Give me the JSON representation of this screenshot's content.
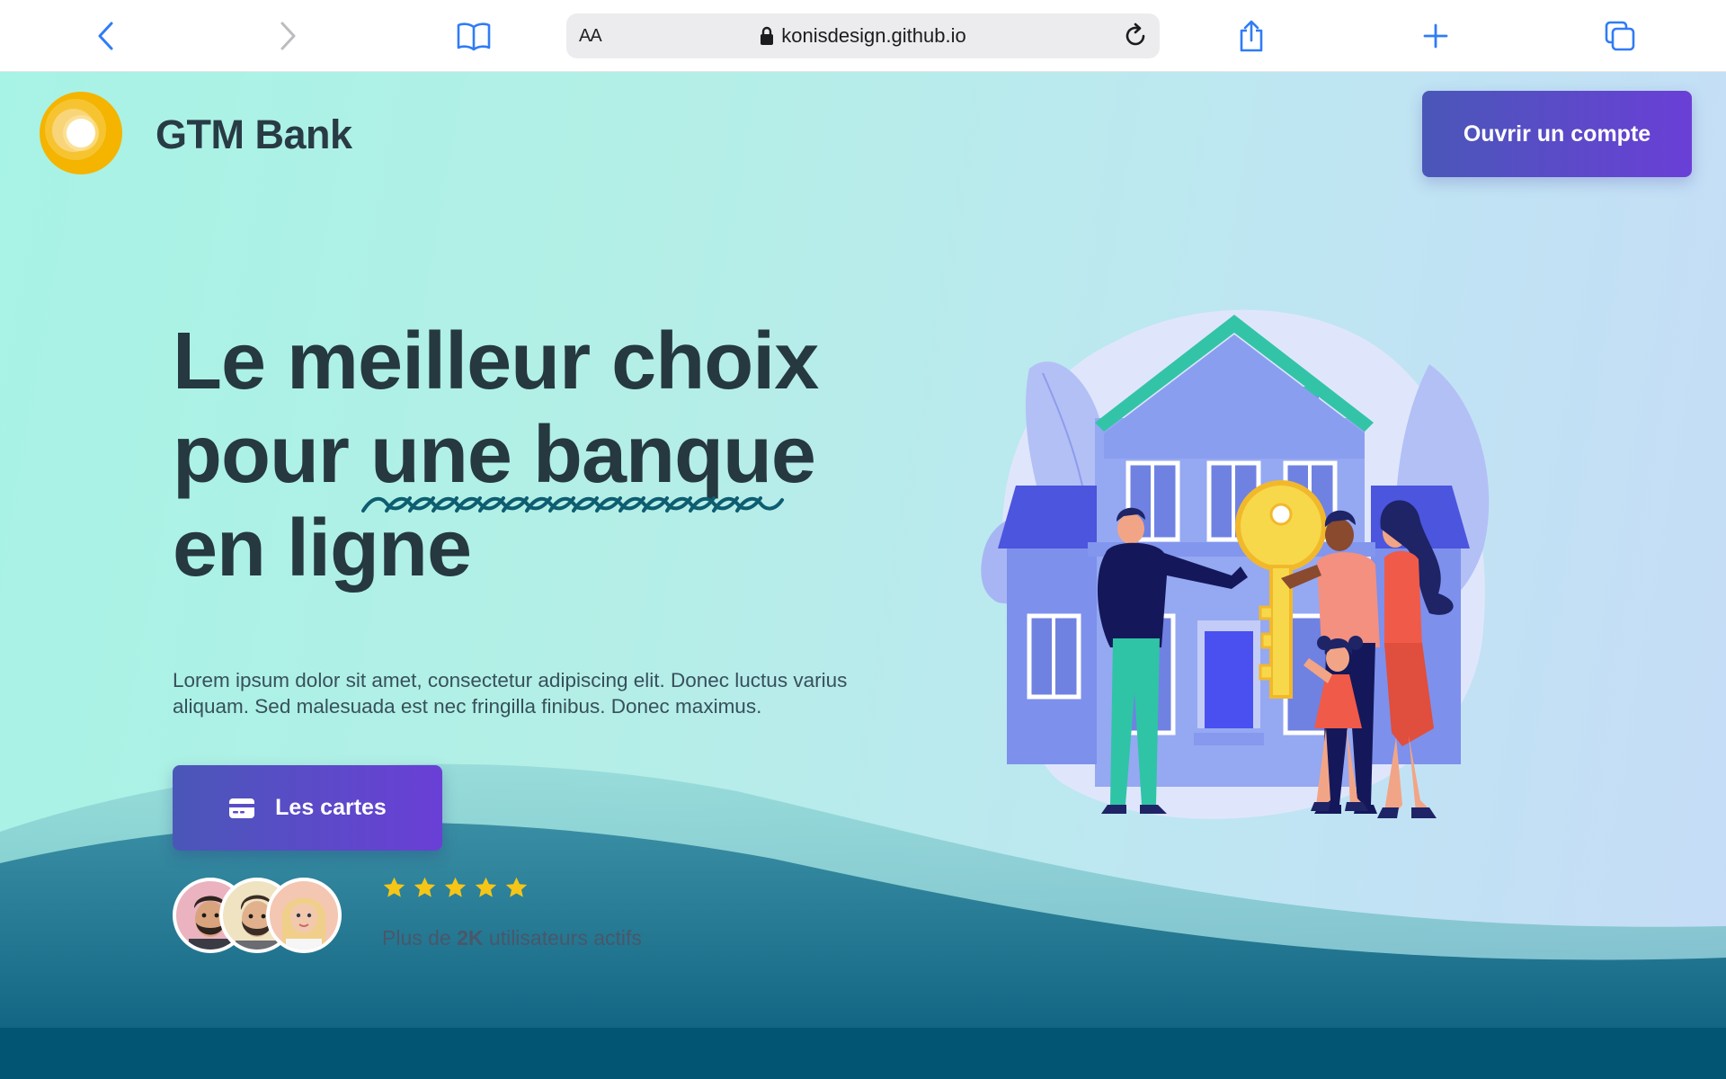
{
  "browser": {
    "reader_label": "AA",
    "url": "konisdesign.github.io"
  },
  "header": {
    "brand": "GTM Bank",
    "open_account": "Ouvrir un compte"
  },
  "hero": {
    "line1": "Le meilleur choix",
    "line2_start": "pour ",
    "line2_highlight": "une banque",
    "line3": "en ligne",
    "description": "Lorem ipsum dolor sit amet, consectetur adipiscing elit. Donec luctus varius aliquam. Sed malesuada est nec fringilla finibus. Donec maximus.",
    "cards_button": "Les cartes"
  },
  "social_proof": {
    "rating_stars": 5,
    "users_prefix": "Plus de ",
    "users_count": "2K",
    "users_suffix": " utilisateurs actifs"
  },
  "colors": {
    "accent_start": "#4a57b8",
    "accent_end": "#6a3fd6",
    "heading": "#263840",
    "star": "#f5c518",
    "ios_blue": "#2f7cf6"
  }
}
